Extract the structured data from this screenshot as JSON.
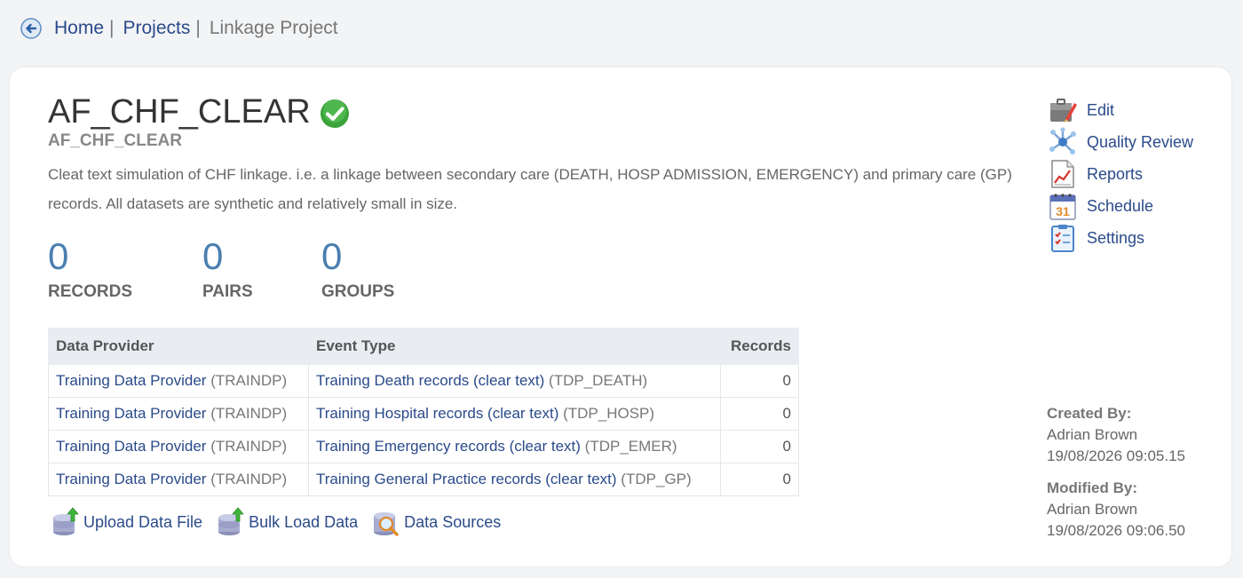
{
  "breadcrumb": {
    "home": "Home",
    "sep1": "|",
    "projects": "Projects",
    "sep2": "|",
    "current": "Linkage Project"
  },
  "project": {
    "title": "AF_CHF_CLEAR",
    "subtitle": "AF_CHF_CLEAR",
    "description": "Cleat text simulation of CHF linkage. i.e. a linkage between secondary care (DEATH, HOSP ADMISSION, EMERGENCY) and primary care (GP) records. All datasets are synthetic and relatively small in size.",
    "status_icon": "green-check-icon"
  },
  "stats": [
    {
      "value": "0",
      "label": "RECORDS"
    },
    {
      "value": "0",
      "label": "PAIRS"
    },
    {
      "value": "0",
      "label": "GROUPS"
    }
  ],
  "table": {
    "headers": [
      "Data Provider",
      "Event Type",
      "Records"
    ],
    "rows": [
      {
        "provider": "Training Data Provider",
        "provider_code": "(TRAINDP)",
        "event": "Training Death records (clear text)",
        "event_code": "(TDP_DEATH)",
        "records": "0"
      },
      {
        "provider": "Training Data Provider",
        "provider_code": "(TRAINDP)",
        "event": "Training Hospital records (clear text)",
        "event_code": "(TDP_HOSP)",
        "records": "0"
      },
      {
        "provider": "Training Data Provider",
        "provider_code": "(TRAINDP)",
        "event": "Training Emergency records (clear text)",
        "event_code": "(TDP_EMER)",
        "records": "0"
      },
      {
        "provider": "Training Data Provider",
        "provider_code": "(TRAINDP)",
        "event": "Training General Practice records (clear text)",
        "event_code": "(TDP_GP)",
        "records": "0"
      }
    ]
  },
  "actions": {
    "upload": "Upload Data File",
    "bulk": "Bulk Load Data",
    "sources": "Data Sources"
  },
  "side_menu": {
    "edit": "Edit",
    "quality": "Quality Review",
    "reports": "Reports",
    "schedule": "Schedule",
    "settings": "Settings"
  },
  "meta": {
    "created_label": "Created By:",
    "created_by": "Adrian Brown",
    "created_at": "19/08/2026 09:05.15",
    "modified_label": "Modified By:",
    "modified_by": "Adrian Brown",
    "modified_at": "19/08/2026 09:06.50"
  },
  "colors": {
    "link": "#2a4a8a",
    "stat_number": "#4a7fb0",
    "table_header_bg": "#e9edf2",
    "check_green": "#3aa33a"
  }
}
